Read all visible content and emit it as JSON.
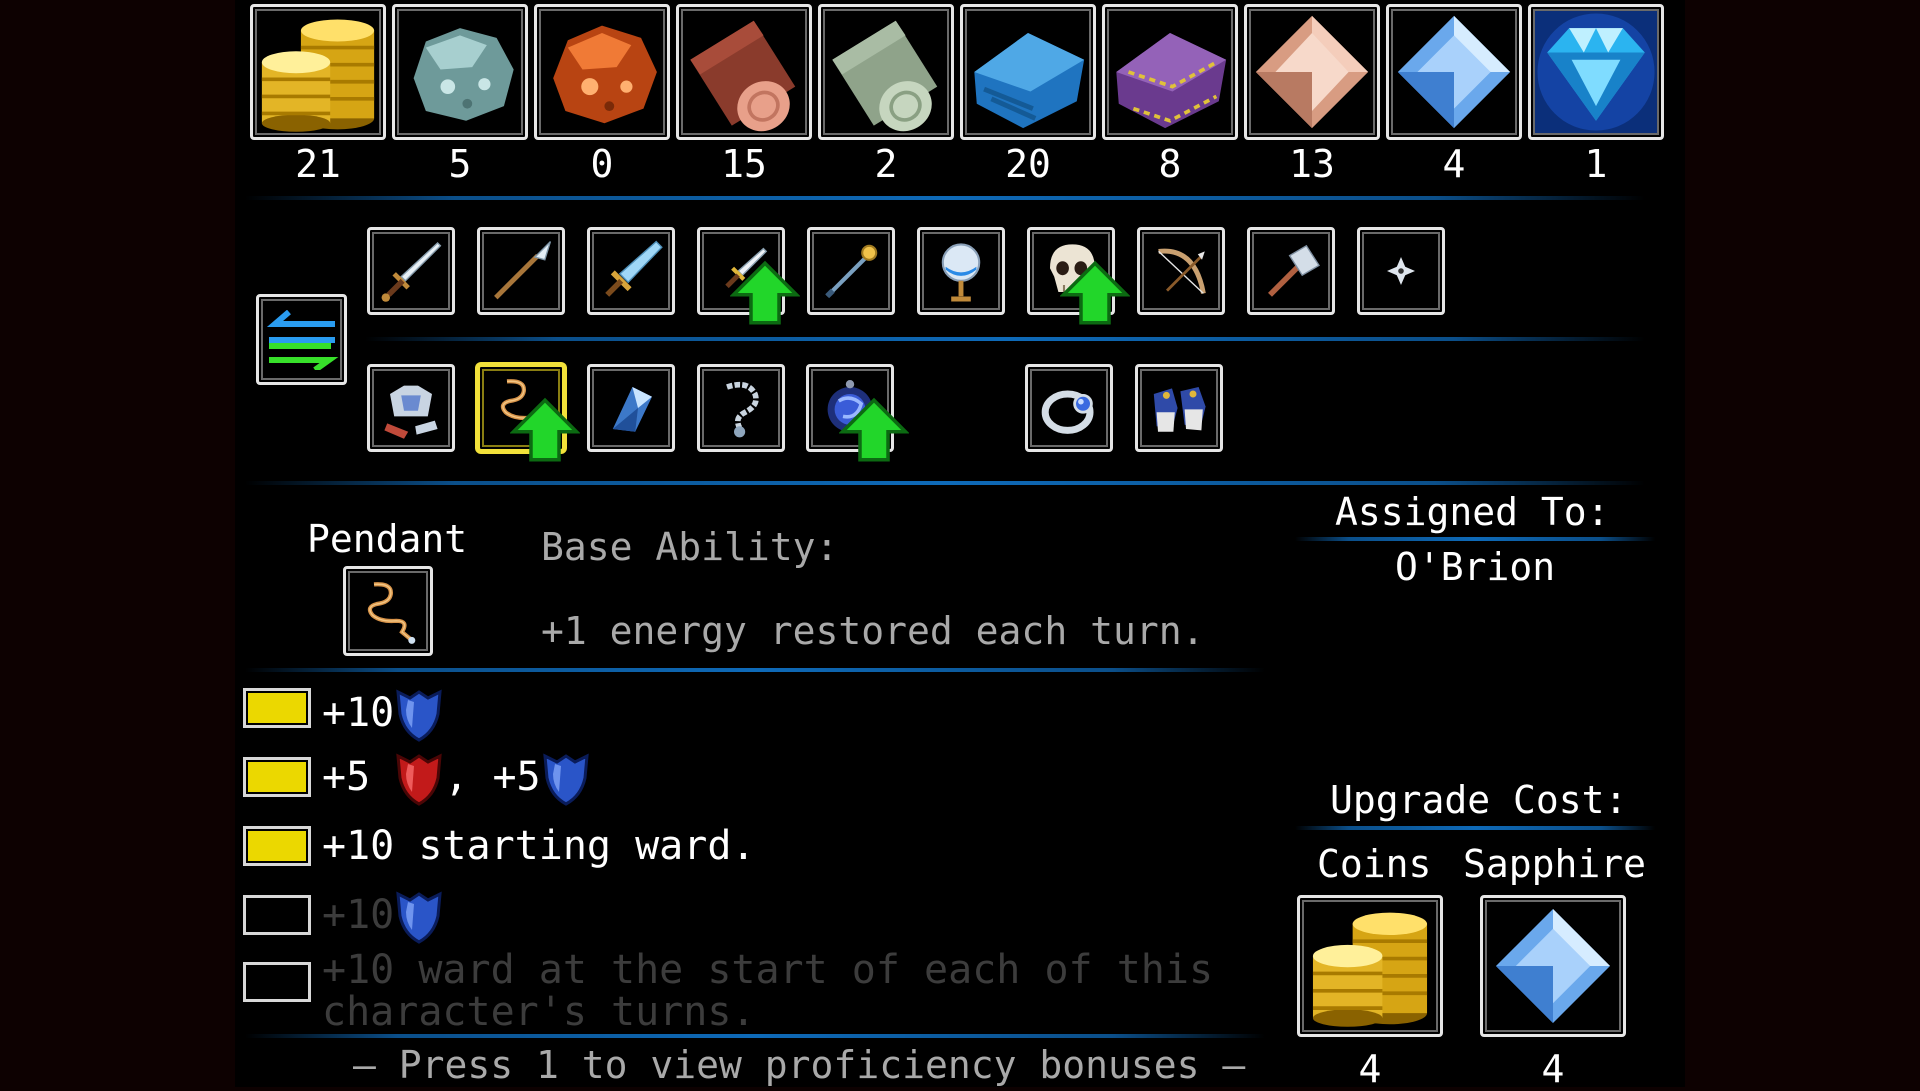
{
  "resources": [
    {
      "name": "coins-icon",
      "count": "21"
    },
    {
      "name": "silver-ore-icon",
      "count": "5"
    },
    {
      "name": "copper-ore-icon",
      "count": "0"
    },
    {
      "name": "wood-log-icon",
      "count": "15"
    },
    {
      "name": "birch-log-icon",
      "count": "2"
    },
    {
      "name": "blue-cloth-icon",
      "count": "20"
    },
    {
      "name": "purple-cloth-icon",
      "count": "8"
    },
    {
      "name": "rose-quartz-icon",
      "count": "13"
    },
    {
      "name": "sapphire-icon",
      "count": "4"
    },
    {
      "name": "diamond-icon",
      "count": "1"
    }
  ],
  "weapons": [
    {
      "name": "sword-icon",
      "upgrade": false
    },
    {
      "name": "spear-icon",
      "upgrade": false
    },
    {
      "name": "broadsword-icon",
      "upgrade": false
    },
    {
      "name": "dagger-icon",
      "upgrade": true
    },
    {
      "name": "staff-icon",
      "upgrade": false
    },
    {
      "name": "orb-icon",
      "upgrade": false
    },
    {
      "name": "skull-icon",
      "upgrade": true
    },
    {
      "name": "bow-icon",
      "upgrade": false
    },
    {
      "name": "warhammer-icon",
      "upgrade": false
    },
    {
      "name": "shuriken-icon",
      "upgrade": false
    }
  ],
  "armor": [
    {
      "name": "chest-armor-icon",
      "upgrade": false,
      "selected": false
    },
    {
      "name": "pendant-icon",
      "upgrade": true,
      "selected": true
    },
    {
      "name": "crystal-icon",
      "upgrade": false,
      "selected": false
    },
    {
      "name": "chain-icon",
      "upgrade": false,
      "selected": false
    },
    {
      "name": "blue-amulet-icon",
      "upgrade": true,
      "selected": false
    },
    {
      "name": "ring-icon",
      "upgrade": false,
      "selected": false
    },
    {
      "name": "gauntlets-icon",
      "upgrade": false,
      "selected": false
    }
  ],
  "item": {
    "name": "Pendant",
    "base_ability_label": "Base Ability:",
    "base_ability": "+1 energy restored each turn."
  },
  "assigned": {
    "label": "Assigned To:",
    "character": "O'Brion"
  },
  "bonuses": [
    {
      "unlocked": true,
      "text": "+10"
    },
    {
      "unlocked": true,
      "text_a": "+5",
      "sep": ",",
      "text_b": "+5"
    },
    {
      "unlocked": true,
      "text": "+10 starting ward."
    },
    {
      "unlocked": false,
      "text": "+10"
    },
    {
      "unlocked": false,
      "line1": "+10 ward at the start of each of this",
      "line2": "character's turns."
    }
  ],
  "upgrade_cost": {
    "label": "Upgrade Cost:",
    "items": [
      {
        "name": "Coins",
        "amount": "4"
      },
      {
        "name": "Sapphire",
        "amount": "4"
      }
    ]
  },
  "footer": "– Press 1 to view proficiency bonuses –",
  "colors": {
    "accent_blue": "#0e6ab8",
    "checkbox_on": "#ebd800",
    "upgrade_arrow": "#22d62a",
    "ward_shield": "#2a55c8",
    "armor_shield": "#c21a1a"
  }
}
